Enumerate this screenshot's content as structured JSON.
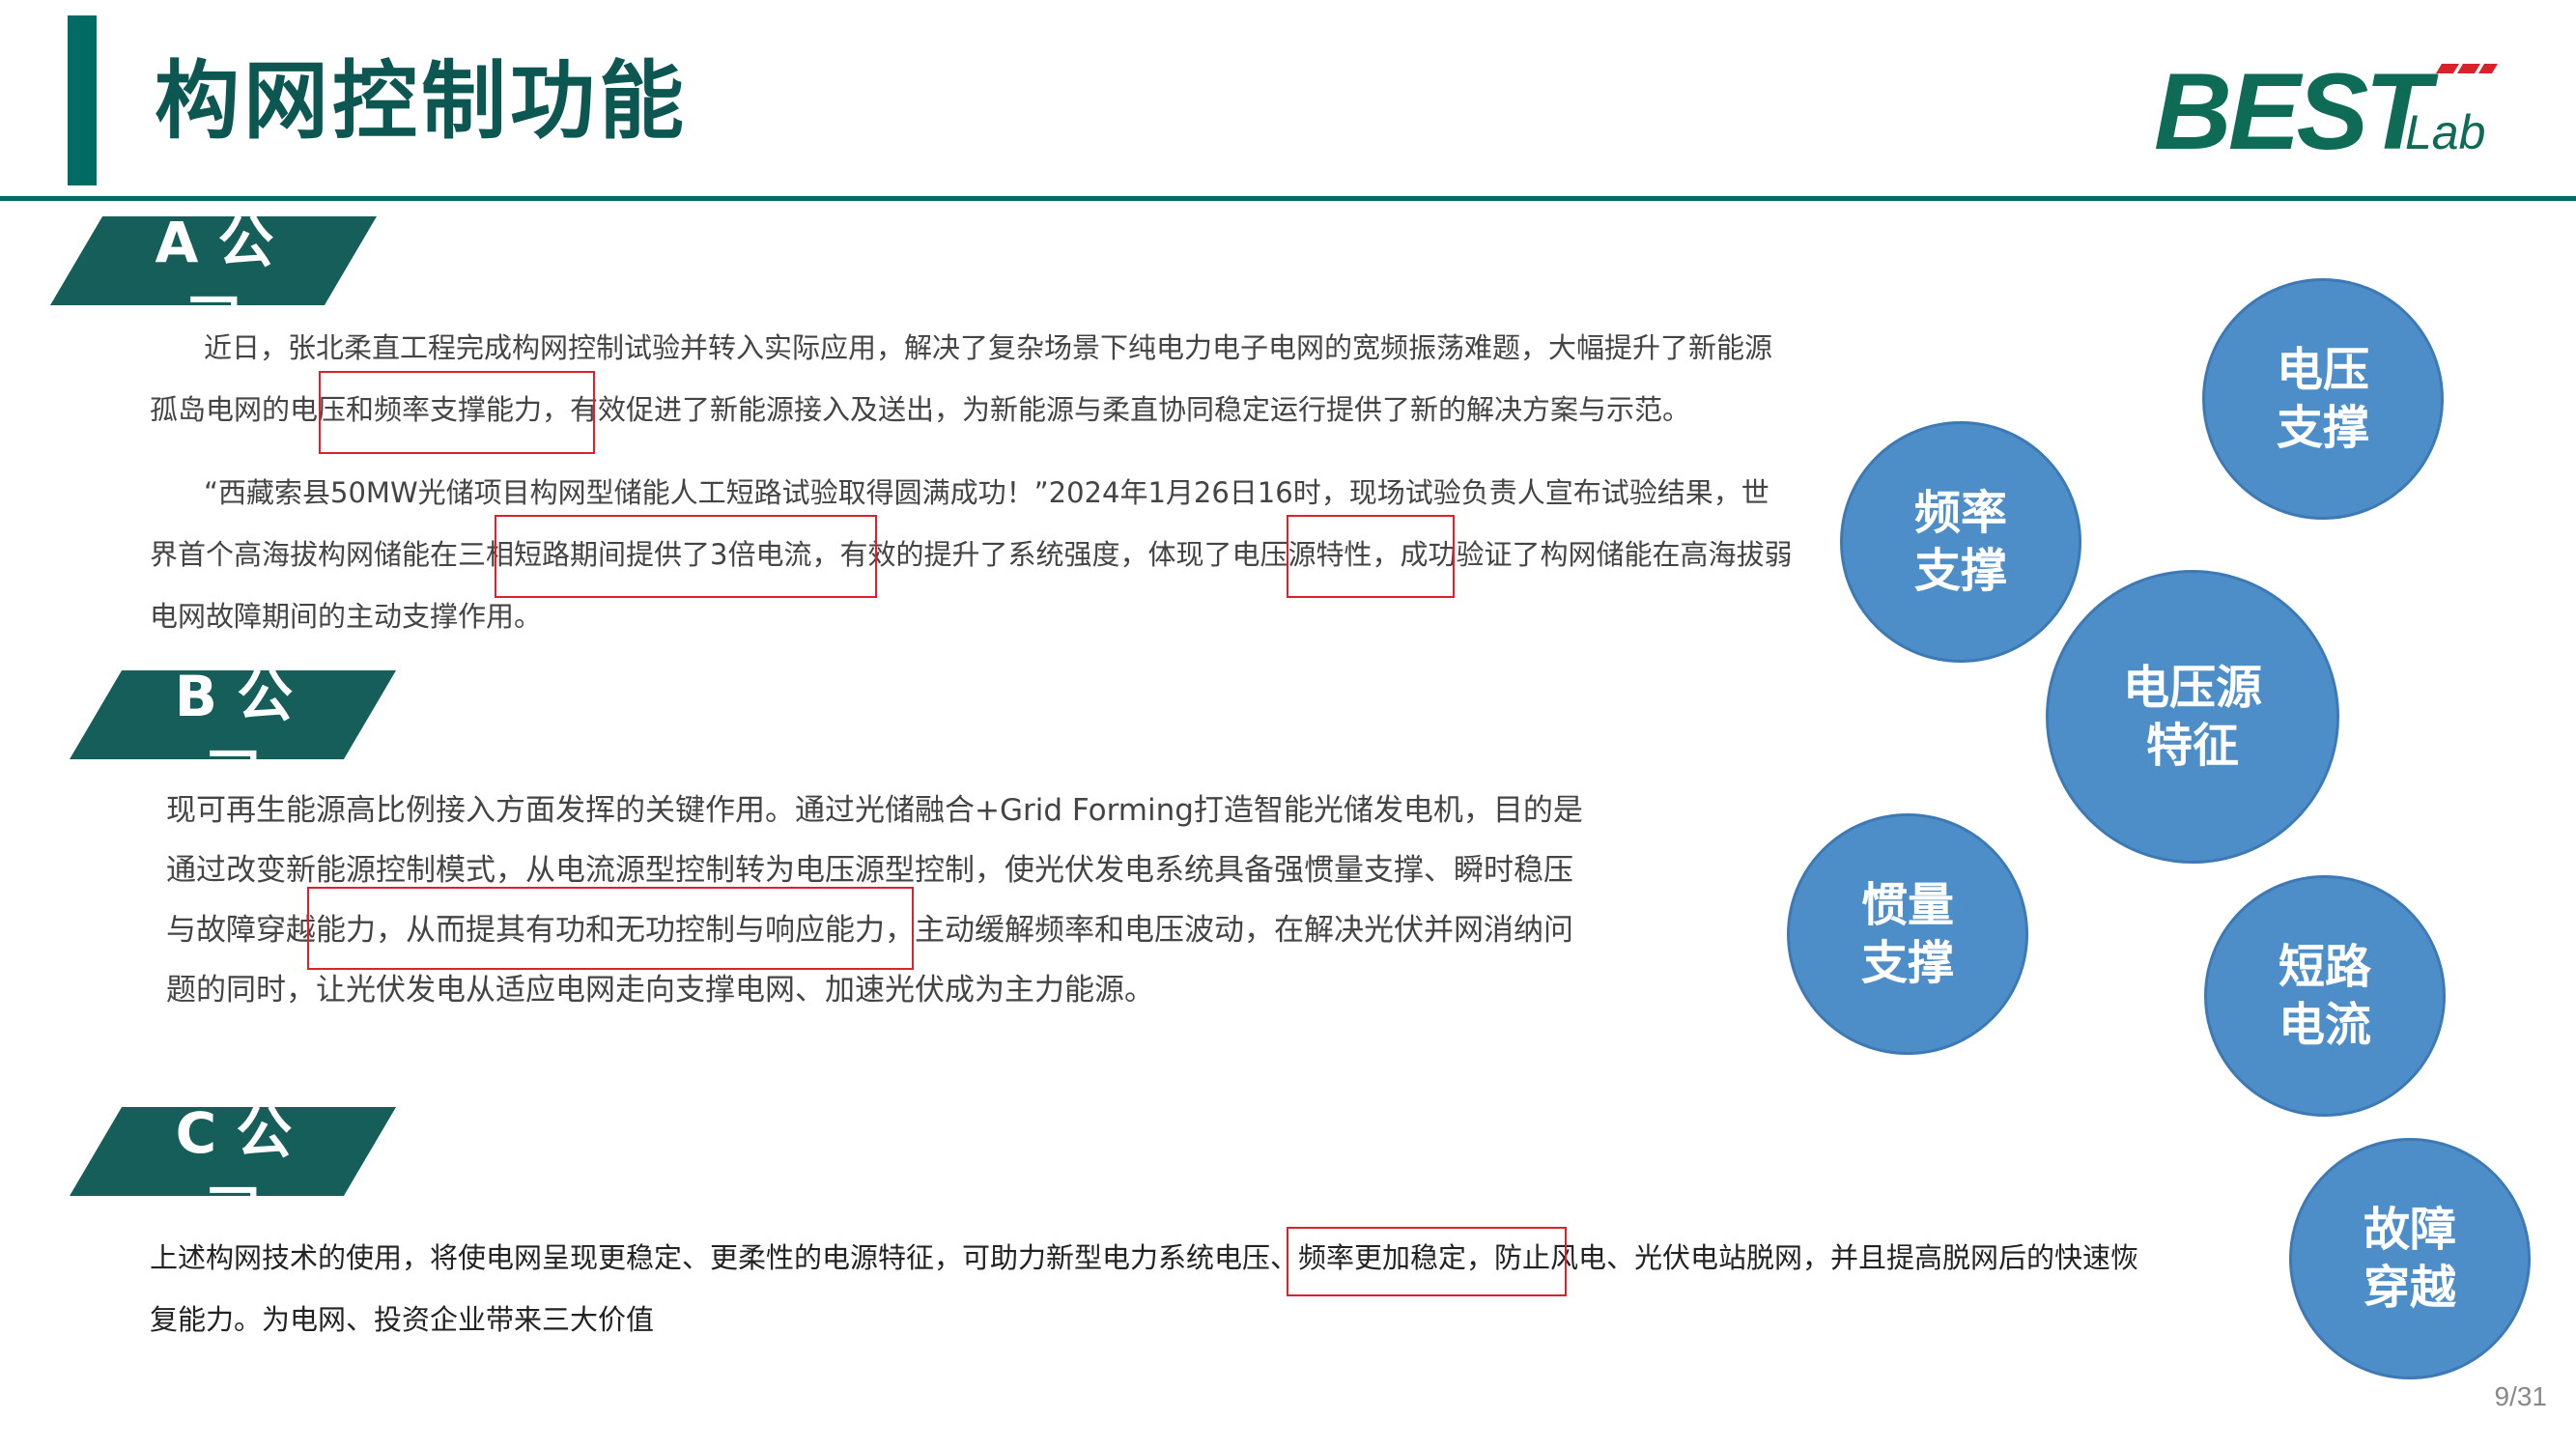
{
  "header": {
    "title": "构网控制功能",
    "logo_main": "BEST",
    "logo_sub": "Lab"
  },
  "sections": [
    {
      "tag_line1": "A 公",
      "tag_line2": "司",
      "paragraphs": [
        "近日，张北柔直工程完成构网控制试验并转入实际应用，解决了复杂场景下纯电力电子电网的宽频振荡难题，大幅提升了新能源孤岛电网的电压和频率支撑能力，有效促进了新能源接入及送出，为新能源与柔直协同稳定运行提供了新的解决方案与示范。",
        "“西藏索县50MW光储项目构网型储能人工短路试验取得圆满成功！”2024年1月26日16时，现场试验负责人宣布试验结果，世界首个高海拔构网储能在三相短路期间提供了3倍电流，有效的提升了系统强度，体现了电压源特性，成功验证了构网储能在高海拔弱电网故障期间的主动支撑作用。"
      ]
    },
    {
      "tag_line1": "B 公",
      "tag_line2": "司",
      "paragraphs": [
        "现可再生能源高比例接入方面发挥的关键作用。通过光储融合+Grid Forming打造智能光储发电机，目的是通过改变新能源控制模式，从电流源型控制转为电压源型控制，使光伏发电系统具备强惯量支撑、瞬时稳压与故障穿越能力，从而提其有功和无功控制与响应能力，主动缓解频率和电压波动，在解决光伏并网消纳问题的同时，让光伏发电从适应电网走向支撑电网、加速光伏成为主力能源。"
      ]
    },
    {
      "tag_line1": "C 公",
      "tag_line2": "司",
      "paragraphs": [
        "上述构网技术的使用，将使电网呈现更稳定、更柔性的电源特征，可助力新型电力系统电压、频率更加稳定，防止风电、光伏电站脱网，并且提高脱网后的快速恢复能力。为电网、投资企业带来三大价值"
      ]
    }
  ],
  "bubbles": [
    {
      "line1": "电压",
      "line2": "支撑"
    },
    {
      "line1": "频率",
      "line2": "支撑"
    },
    {
      "line1": "电压源",
      "line2": "特征"
    },
    {
      "line1": "惯量",
      "line2": "支撑"
    },
    {
      "line1": "短路",
      "line2": "电流"
    },
    {
      "line1": "故障",
      "line2": "穿越"
    }
  ],
  "page_number": "9/31",
  "colors": {
    "brand_teal": "#006b63",
    "title_teal": "#0d5753",
    "bubble_blue": "#4e8ec8",
    "highlight_red": "#d9232c"
  }
}
